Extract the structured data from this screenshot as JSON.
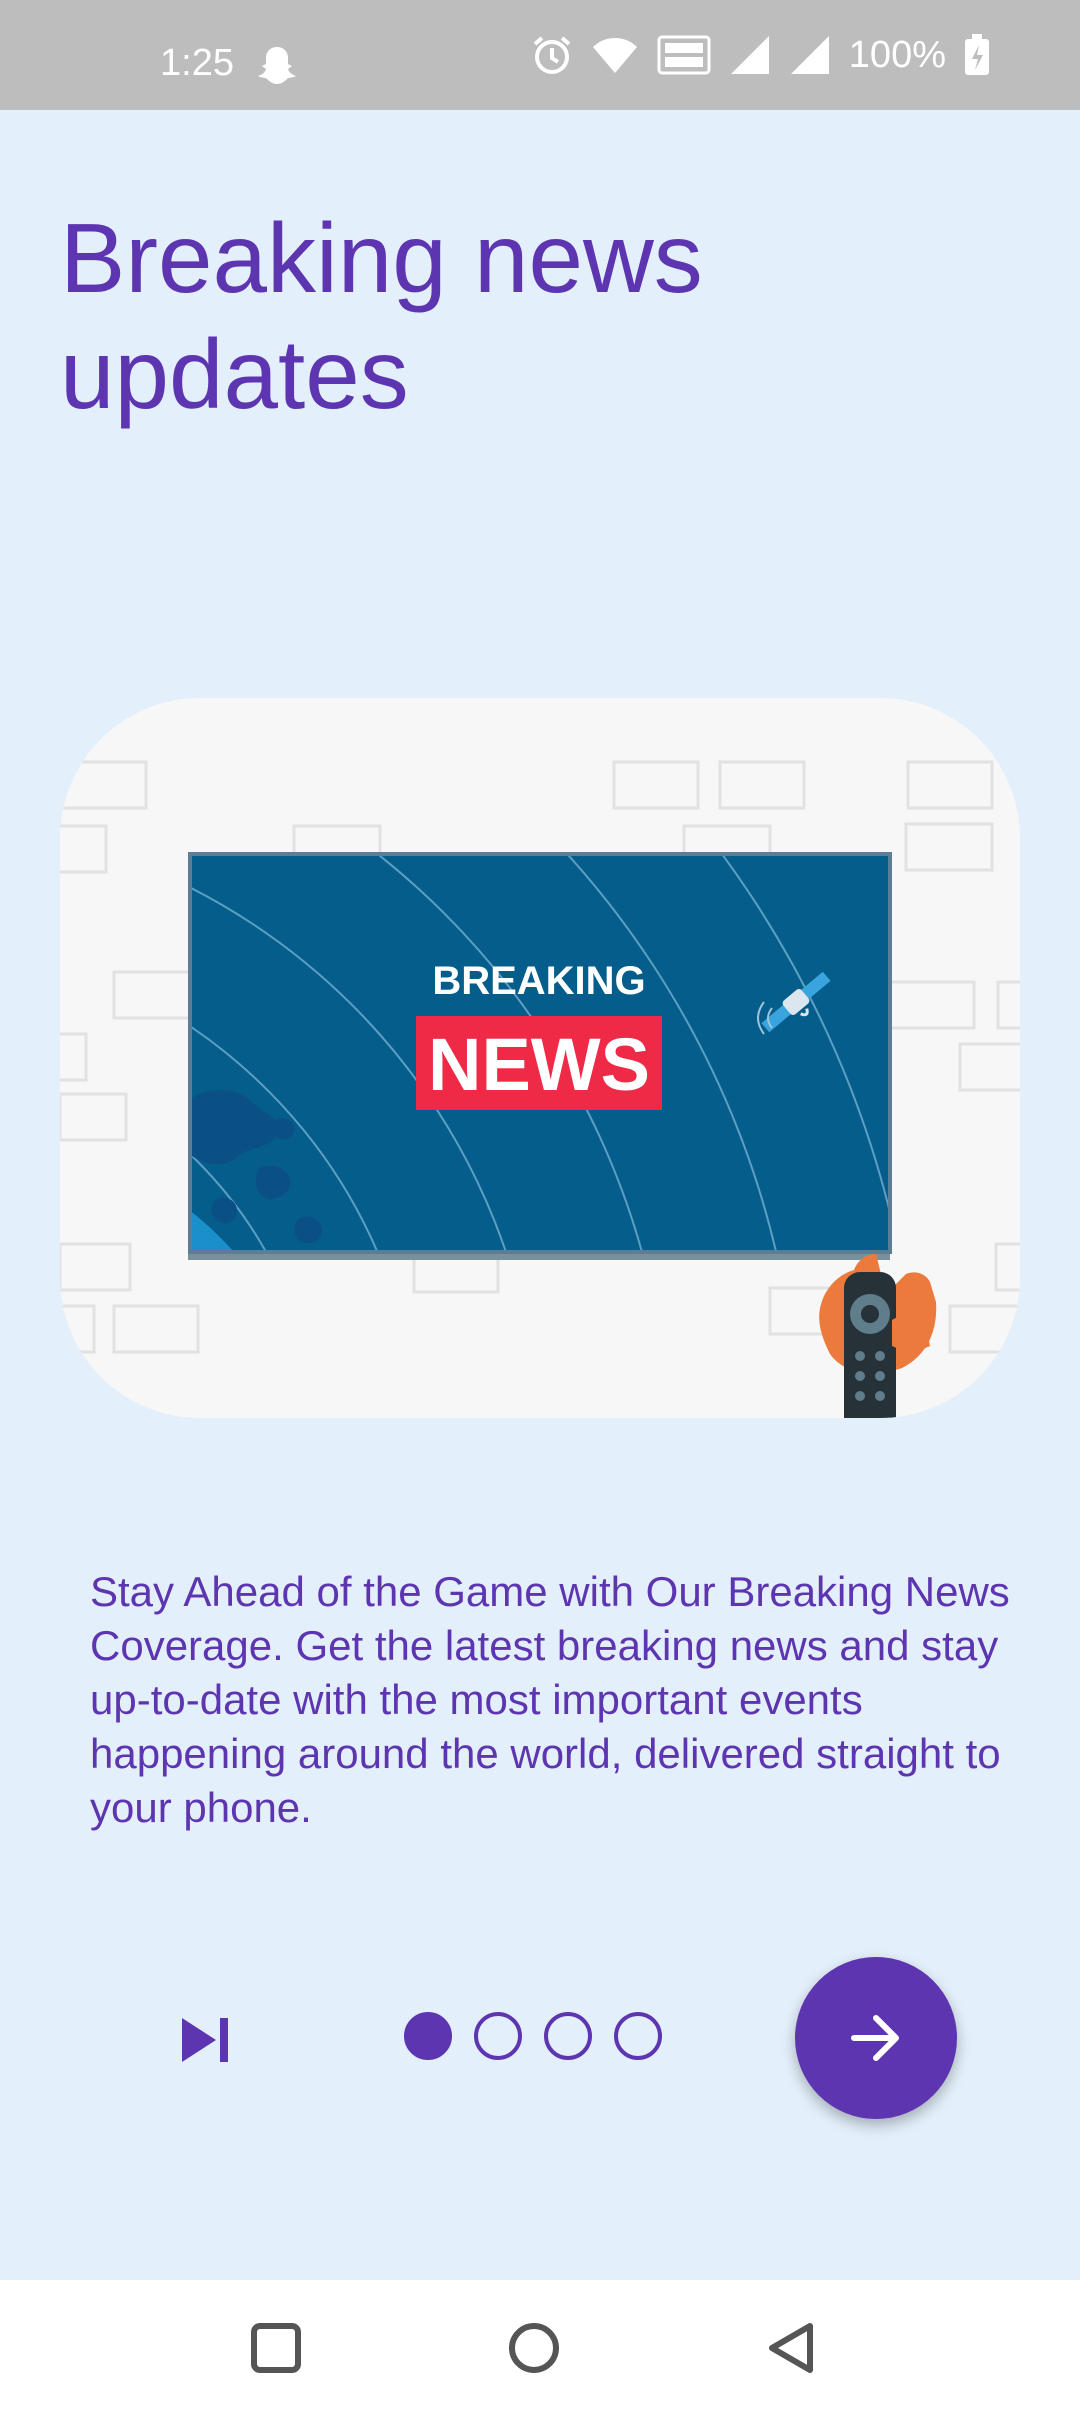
{
  "status_bar": {
    "time": "1:25",
    "battery": "100%",
    "icons": [
      "snapchat-icon",
      "alarm-icon",
      "wifi-icon",
      "volte-icon",
      "signal-icon",
      "signal-icon",
      "battery-charging-icon"
    ]
  },
  "onboarding": {
    "title": "Breaking news updates",
    "illustration": {
      "line1": "BREAKING",
      "line2": "NEWS"
    },
    "description": "Stay Ahead of the Game with Our Breaking News Coverage. Get the latest breaking news and stay up-to-date with the most important events happening around the world, delivered straight to your phone.",
    "pager": {
      "total": 4,
      "current": 1
    },
    "skip_icon": "skip-next-icon",
    "next_icon": "arrow-right-icon"
  },
  "nav_bar": {
    "buttons": [
      "recents-square-icon",
      "home-circle-icon",
      "back-triangle-icon"
    ]
  },
  "colors": {
    "accent": "#5e35b1",
    "background": "#e3effa",
    "status_bar": "#bdbdbd",
    "tv_screen": "#045d8b",
    "news_red": "#ee2a47"
  }
}
